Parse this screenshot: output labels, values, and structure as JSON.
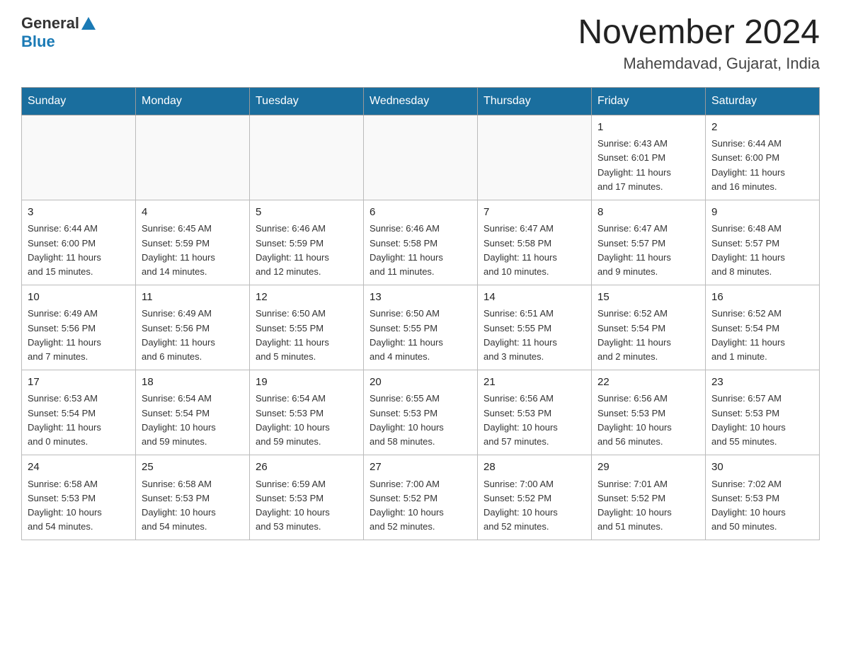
{
  "header": {
    "logo_general": "General",
    "logo_blue": "Blue",
    "month_year": "November 2024",
    "location": "Mahemdavad, Gujarat, India"
  },
  "weekdays": [
    "Sunday",
    "Monday",
    "Tuesday",
    "Wednesday",
    "Thursday",
    "Friday",
    "Saturday"
  ],
  "weeks": [
    [
      {
        "day": "",
        "info": ""
      },
      {
        "day": "",
        "info": ""
      },
      {
        "day": "",
        "info": ""
      },
      {
        "day": "",
        "info": ""
      },
      {
        "day": "",
        "info": ""
      },
      {
        "day": "1",
        "info": "Sunrise: 6:43 AM\nSunset: 6:01 PM\nDaylight: 11 hours\nand 17 minutes."
      },
      {
        "day": "2",
        "info": "Sunrise: 6:44 AM\nSunset: 6:00 PM\nDaylight: 11 hours\nand 16 minutes."
      }
    ],
    [
      {
        "day": "3",
        "info": "Sunrise: 6:44 AM\nSunset: 6:00 PM\nDaylight: 11 hours\nand 15 minutes."
      },
      {
        "day": "4",
        "info": "Sunrise: 6:45 AM\nSunset: 5:59 PM\nDaylight: 11 hours\nand 14 minutes."
      },
      {
        "day": "5",
        "info": "Sunrise: 6:46 AM\nSunset: 5:59 PM\nDaylight: 11 hours\nand 12 minutes."
      },
      {
        "day": "6",
        "info": "Sunrise: 6:46 AM\nSunset: 5:58 PM\nDaylight: 11 hours\nand 11 minutes."
      },
      {
        "day": "7",
        "info": "Sunrise: 6:47 AM\nSunset: 5:58 PM\nDaylight: 11 hours\nand 10 minutes."
      },
      {
        "day": "8",
        "info": "Sunrise: 6:47 AM\nSunset: 5:57 PM\nDaylight: 11 hours\nand 9 minutes."
      },
      {
        "day": "9",
        "info": "Sunrise: 6:48 AM\nSunset: 5:57 PM\nDaylight: 11 hours\nand 8 minutes."
      }
    ],
    [
      {
        "day": "10",
        "info": "Sunrise: 6:49 AM\nSunset: 5:56 PM\nDaylight: 11 hours\nand 7 minutes."
      },
      {
        "day": "11",
        "info": "Sunrise: 6:49 AM\nSunset: 5:56 PM\nDaylight: 11 hours\nand 6 minutes."
      },
      {
        "day": "12",
        "info": "Sunrise: 6:50 AM\nSunset: 5:55 PM\nDaylight: 11 hours\nand 5 minutes."
      },
      {
        "day": "13",
        "info": "Sunrise: 6:50 AM\nSunset: 5:55 PM\nDaylight: 11 hours\nand 4 minutes."
      },
      {
        "day": "14",
        "info": "Sunrise: 6:51 AM\nSunset: 5:55 PM\nDaylight: 11 hours\nand 3 minutes."
      },
      {
        "day": "15",
        "info": "Sunrise: 6:52 AM\nSunset: 5:54 PM\nDaylight: 11 hours\nand 2 minutes."
      },
      {
        "day": "16",
        "info": "Sunrise: 6:52 AM\nSunset: 5:54 PM\nDaylight: 11 hours\nand 1 minute."
      }
    ],
    [
      {
        "day": "17",
        "info": "Sunrise: 6:53 AM\nSunset: 5:54 PM\nDaylight: 11 hours\nand 0 minutes."
      },
      {
        "day": "18",
        "info": "Sunrise: 6:54 AM\nSunset: 5:54 PM\nDaylight: 10 hours\nand 59 minutes."
      },
      {
        "day": "19",
        "info": "Sunrise: 6:54 AM\nSunset: 5:53 PM\nDaylight: 10 hours\nand 59 minutes."
      },
      {
        "day": "20",
        "info": "Sunrise: 6:55 AM\nSunset: 5:53 PM\nDaylight: 10 hours\nand 58 minutes."
      },
      {
        "day": "21",
        "info": "Sunrise: 6:56 AM\nSunset: 5:53 PM\nDaylight: 10 hours\nand 57 minutes."
      },
      {
        "day": "22",
        "info": "Sunrise: 6:56 AM\nSunset: 5:53 PM\nDaylight: 10 hours\nand 56 minutes."
      },
      {
        "day": "23",
        "info": "Sunrise: 6:57 AM\nSunset: 5:53 PM\nDaylight: 10 hours\nand 55 minutes."
      }
    ],
    [
      {
        "day": "24",
        "info": "Sunrise: 6:58 AM\nSunset: 5:53 PM\nDaylight: 10 hours\nand 54 minutes."
      },
      {
        "day": "25",
        "info": "Sunrise: 6:58 AM\nSunset: 5:53 PM\nDaylight: 10 hours\nand 54 minutes."
      },
      {
        "day": "26",
        "info": "Sunrise: 6:59 AM\nSunset: 5:53 PM\nDaylight: 10 hours\nand 53 minutes."
      },
      {
        "day": "27",
        "info": "Sunrise: 7:00 AM\nSunset: 5:52 PM\nDaylight: 10 hours\nand 52 minutes."
      },
      {
        "day": "28",
        "info": "Sunrise: 7:00 AM\nSunset: 5:52 PM\nDaylight: 10 hours\nand 52 minutes."
      },
      {
        "day": "29",
        "info": "Sunrise: 7:01 AM\nSunset: 5:52 PM\nDaylight: 10 hours\nand 51 minutes."
      },
      {
        "day": "30",
        "info": "Sunrise: 7:02 AM\nSunset: 5:53 PM\nDaylight: 10 hours\nand 50 minutes."
      }
    ]
  ]
}
